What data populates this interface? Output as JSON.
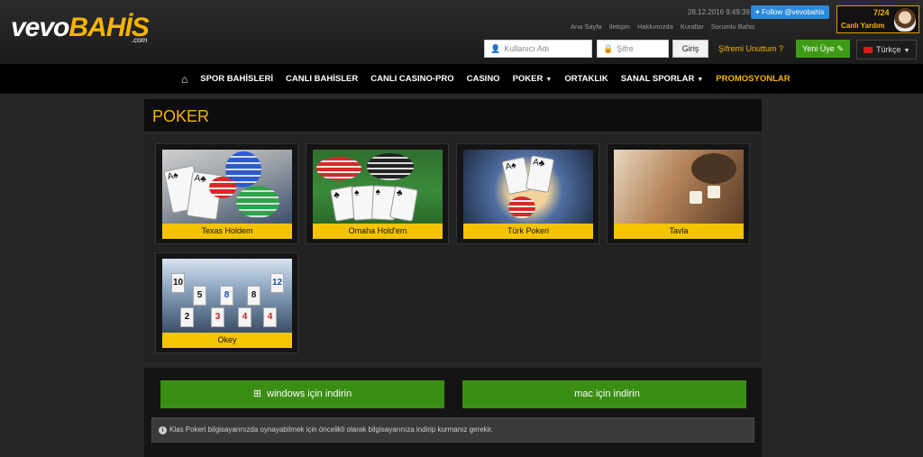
{
  "brand": {
    "logo_part1": "vevo",
    "logo_part2": "BAHİS",
    "logo_sub": ".com"
  },
  "topbar": {
    "datetime": "28.12.2016 9:49:39",
    "twitter_label": "Follow @vevobahis",
    "links": [
      "Ana Sayfa",
      "İletişim",
      "Hakkımızda",
      "Kurallar",
      "Sorumlu Bahis"
    ],
    "support": {
      "hours": "7/24",
      "label": "Canlı Yardım"
    }
  },
  "login": {
    "username_placeholder": "Kullanıcı Adı",
    "password_placeholder": "Şifre",
    "submit_label": "Giriş",
    "forgot_label": "Şifremi Unuttum ?",
    "signup_label": "Yeni Üye",
    "language_label": "Türkçe"
  },
  "nav": {
    "items": [
      "SPOR BAHİSLERİ",
      "CANLI BAHİSLER",
      "CANLI CASINO-PRO",
      "CASINO",
      "POKER",
      "ORTAKLIK",
      "SANAL SPORLAR",
      "PROMOSYONLAR"
    ]
  },
  "page": {
    "title": "POKER",
    "games": [
      {
        "label": "Texas Holdem"
      },
      {
        "label": "Omaha Hold'em"
      },
      {
        "label": "Türk Pokeri"
      },
      {
        "label": "Tavla"
      },
      {
        "label": "Okey"
      }
    ]
  },
  "download": {
    "windows_label": "windows için indirin",
    "mac_label": "mac için indirin",
    "notice": "Klas Pokeri bilgisayarınızda oynayabilmek için öncelikli olarak bilgisayarınıza indirip kurmanız gerekir."
  },
  "colors": {
    "accent": "#f5b400",
    "button_green": "#3a8e14",
    "card_label": "#f5c400"
  },
  "icons": [
    "home-icon",
    "user-icon",
    "lock-icon",
    "edit-icon",
    "flag-icon",
    "twitter-icon",
    "windows-icon",
    "apple-icon",
    "info-icon"
  ]
}
